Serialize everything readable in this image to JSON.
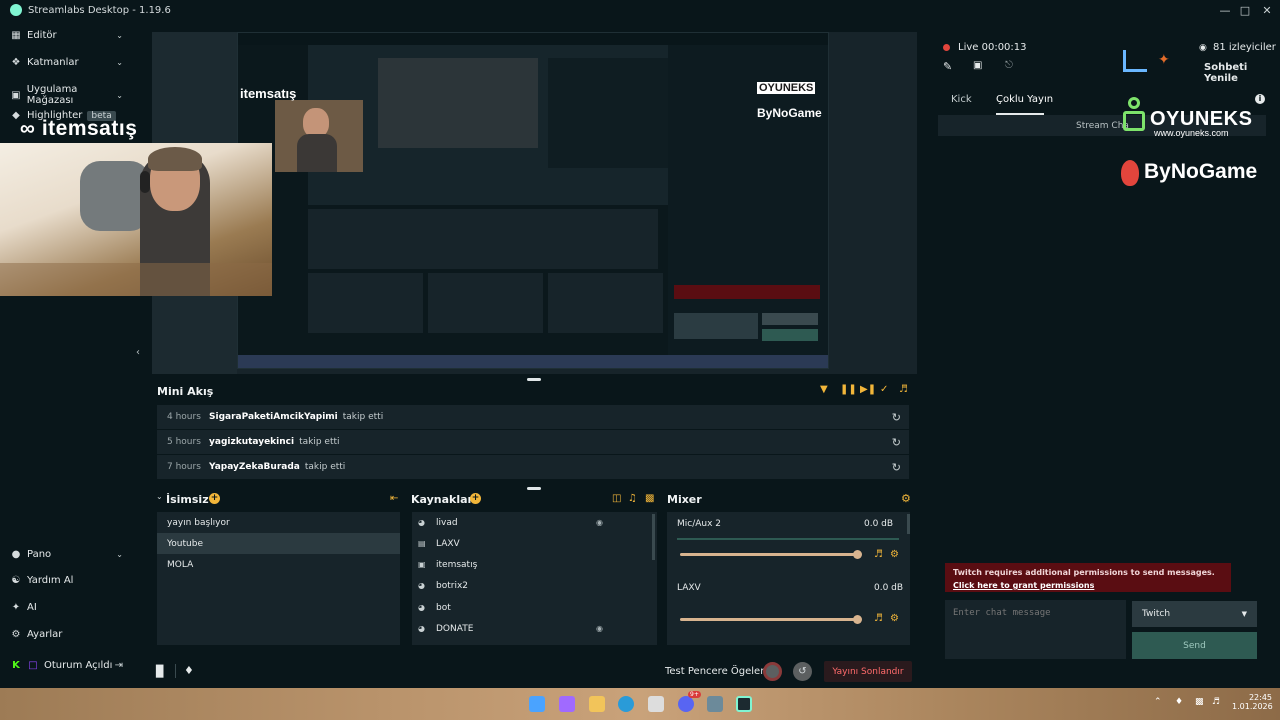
{
  "app": {
    "title": "Streamlabs Desktop - 1.19.6"
  },
  "colors": {
    "accent": "#80f5d2",
    "live_red": "#e2453c",
    "bg": "#09161a",
    "panel": "#17242a",
    "end_stream": "#ff6b6b",
    "warning_bg": "#5a0d12"
  },
  "sidebar": {
    "top_items": [
      {
        "label": "Editör",
        "icon": "editor-icon"
      },
      {
        "label": "Katmanlar",
        "icon": "layers-icon"
      },
      {
        "label": "Uygulama Mağazası",
        "icon": "store-icon"
      },
      {
        "label": "Highlighter",
        "icon": "highlighter-icon",
        "badge": "beta"
      }
    ],
    "bottom_items": [
      {
        "label": "Pano",
        "icon": "dashboard-icon"
      },
      {
        "label": "Yardım Al",
        "icon": "help-icon"
      },
      {
        "label": "AI",
        "icon": "ai-icon"
      },
      {
        "label": "Ayarlar",
        "icon": "settings-icon"
      },
      {
        "label": "Oturum Açıldı",
        "icon": "logged-in-icon"
      }
    ]
  },
  "overlay": {
    "itemsatis": "itemsatış",
    "oyuneks": "OYUNEKS",
    "oyuneks_url": "www.oyuneks.com",
    "bynogame": "ByNoGame"
  },
  "mini_feed": {
    "title": "Mini Akış",
    "rows": [
      {
        "time": "4 hours",
        "user": "SigaraPaketiAmcikYapimi",
        "action": "takip etti"
      },
      {
        "time": "5 hours",
        "user": "yagizkutayekinci",
        "action": "takip etti"
      },
      {
        "time": "7 hours",
        "user": "YapayZekaBurada",
        "action": "takip etti"
      }
    ]
  },
  "scenes": {
    "title": "İsimsiz",
    "items": [
      "yayın başlıyor",
      "Youtube",
      "MOLA"
    ],
    "selected": 1
  },
  "sources": {
    "title": "Kaynaklar",
    "items": [
      {
        "label": "livad",
        "icon": "globe-icon",
        "locked": true
      },
      {
        "label": "LAXV",
        "icon": "file-icon",
        "locked": false
      },
      {
        "label": "itemsatış",
        "icon": "image-icon",
        "locked": false
      },
      {
        "label": "botrix2",
        "icon": "globe-icon",
        "locked": false
      },
      {
        "label": "bot",
        "icon": "globe-icon",
        "locked": false
      },
      {
        "label": "DONATE",
        "icon": "globe-icon",
        "locked": true
      }
    ]
  },
  "mixer": {
    "title": "Mixer",
    "channels": [
      {
        "name": "Mic/Aux 2",
        "db": "0.0 dB",
        "level": 1.0
      },
      {
        "name": "LAXV",
        "db": "0.0 dB",
        "level": 1.0
      }
    ]
  },
  "footer": {
    "test_widgets": "Test Pencere Ögeleri",
    "end_stream": "Yayını Sonlandır"
  },
  "chat": {
    "live_label": "Live 00:00:13",
    "viewers": "81 izleyiciler",
    "refresh": "Sohbeti Yenile",
    "tabs": [
      "Kick",
      "Çoklu Yayın"
    ],
    "active_tab": 1,
    "stream_chat_label": "Stream Cha",
    "warning_text": "Twitch requires additional permissions to send messages.",
    "warning_link": "Click here to grant permissions",
    "input_placeholder": "Enter chat message",
    "platform": "Twitch",
    "send": "Send"
  },
  "taskbar": {
    "time": "22:45",
    "date": "1.01.2026",
    "discord_badge": "9+"
  }
}
